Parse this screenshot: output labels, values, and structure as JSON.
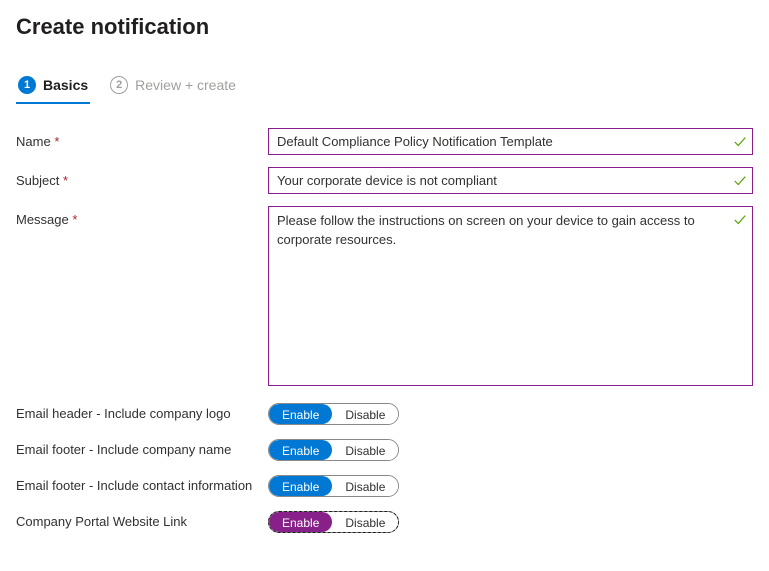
{
  "page_title": "Create notification",
  "tabs": [
    {
      "num": "1",
      "label": "Basics",
      "active": true
    },
    {
      "num": "2",
      "label": "Review + create",
      "active": false
    }
  ],
  "fields": {
    "name": {
      "label": "Name",
      "value": "Default Compliance Policy Notification Template"
    },
    "subject": {
      "label": "Subject",
      "value": "Your corporate device is not compliant"
    },
    "message": {
      "label": "Message",
      "value": "Please follow the instructions on screen on your device to gain access to corporate resources."
    }
  },
  "toggle_labels": {
    "enable": "Enable",
    "disable": "Disable"
  },
  "toggles": {
    "header_logo": {
      "label": "Email header - Include company logo",
      "value": "Enable",
      "style": "blue"
    },
    "footer_name": {
      "label": "Email footer - Include company name",
      "value": "Enable",
      "style": "blue"
    },
    "footer_contact": {
      "label": "Email footer - Include contact information",
      "value": "Enable",
      "style": "blue"
    },
    "portal_link": {
      "label": "Company Portal Website Link",
      "value": "Enable",
      "style": "purple"
    }
  }
}
